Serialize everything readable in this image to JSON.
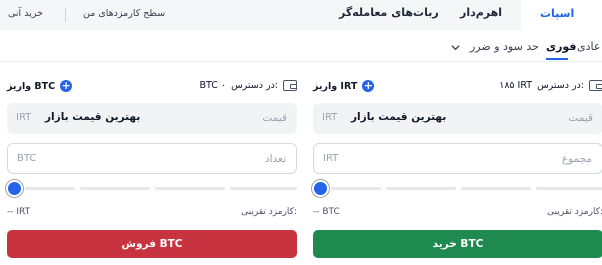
{
  "tabs": {
    "spot": "اسپات",
    "leverage": "اهرم‌دار",
    "bots": "ربات‌های معامله‌گر",
    "fee_level": "سطح کارمزدهای من",
    "buy_instant": "خرید آنی"
  },
  "order_types": {
    "normal": "عادی",
    "instant": "فوری",
    "tp_sl": "حد سود و ضرر"
  },
  "buy": {
    "available_label": "در دسترس:",
    "available_value": "۱۸۵ IRT",
    "deposit_label": "واریز IRT",
    "price_label": "قیمت",
    "price_unit": "IRT",
    "price_value": "بهترین قیمت بازار",
    "total_label": "مجموع",
    "total_unit": "IRT",
    "fee_label": "کارمزد تقریبی:",
    "fee_value": "-- BTC",
    "button_label": "خرید BTC",
    "slider_percent": 0
  },
  "sell": {
    "available_label": "در دسترس:",
    "available_value": "BTC ۰",
    "deposit_label": "واریز BTC",
    "price_label": "قیمت",
    "price_unit": "IRT",
    "price_value": "بهترین قیمت بازار",
    "amount_label": "تعداد",
    "amount_unit": "BTC",
    "fee_label": "کارمزد تقریبی:",
    "fee_value": "-- IRT",
    "button_label": "فروش BTC",
    "slider_percent": 0
  },
  "colors": {
    "accent": "#2563eb",
    "buy": "#1f8a4f",
    "sell": "#c7343f"
  }
}
